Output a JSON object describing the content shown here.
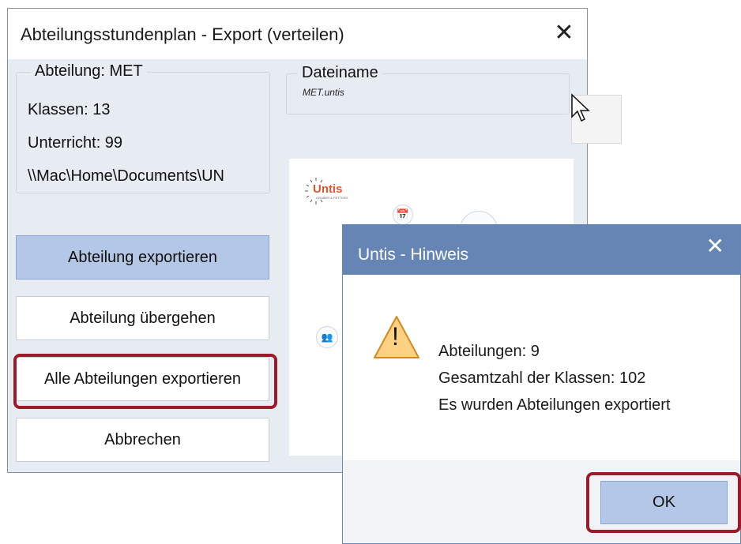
{
  "main_dialog": {
    "title": "Abteilungsstundenplan - Export (verteilen)",
    "close_glyph": "✕",
    "department_group": {
      "legend": "Abteilung: MET",
      "classes": "Klassen: 13",
      "lessons": "Unterricht: 99",
      "path": "\\\\Mac\\Home\\Documents\\UN"
    },
    "filename_group": {
      "legend": "Dateiname",
      "value": "MET.untis"
    },
    "buttons": {
      "export_department": "Abteilung exportieren",
      "skip_department": "Abteilung übergehen",
      "export_all": "Alle Abteilungen exportieren",
      "cancel": "Abbrechen"
    },
    "logo_text": "Untis",
    "logo_subtext": "GRUBER & PETTERS"
  },
  "hint_dialog": {
    "title": "Untis - Hinweis",
    "close_glyph": "✕",
    "warning_glyph": "!",
    "messages": [
      "Abteilungen: 9",
      "Gesamtzahl der Klassen: 102",
      "Es wurden Abteilungen exportiert"
    ],
    "ok_label": "OK"
  },
  "colors": {
    "highlight": "#9b1b2a",
    "primary_button": "#b4c7e6",
    "hint_titlebar": "#6585b5",
    "warning_fill": "#fcd181"
  }
}
